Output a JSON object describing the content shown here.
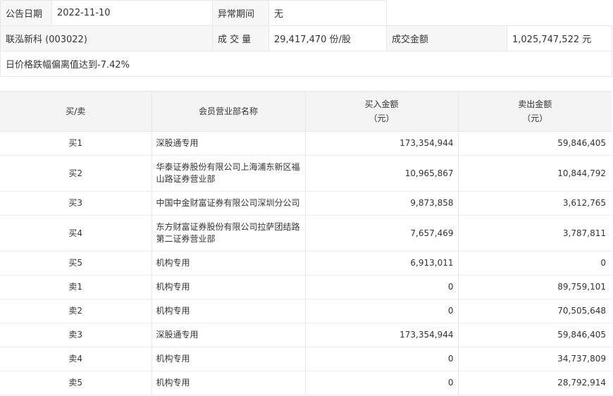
{
  "info": {
    "date_label": "公告日期",
    "date_value": "2022-11-10",
    "period_label": "异常期间",
    "period_value": "无",
    "stock": "联泓新科 (003022)",
    "volume_label": "成 交 量",
    "volume_value": "29,417,470 份/股",
    "amount_label": "成交金额",
    "amount_value": "1,025,747,522 元",
    "reason": "日价格跌幅偏离值达到-7.42%"
  },
  "table": {
    "headers": {
      "side": "买/卖",
      "name": "会员营业部名称",
      "buy": "买入金额",
      "buy_unit": "（元）",
      "sell": "卖出金额",
      "sell_unit": "（元）"
    },
    "rows": [
      {
        "side": "买1",
        "name": "深股通专用",
        "buy": "173,354,944",
        "sell": "59,846,405"
      },
      {
        "side": "买2",
        "name": "华泰证券股份有限公司上海浦东新区福山路证券营业部",
        "buy": "10,965,867",
        "sell": "10,844,792"
      },
      {
        "side": "买3",
        "name": "中国中金财富证券有限公司深圳分公司",
        "buy": "9,873,858",
        "sell": "3,612,765"
      },
      {
        "side": "买4",
        "name": "东方财富证券股份有限公司拉萨团结路第二证券营业部",
        "buy": "7,657,469",
        "sell": "3,787,811"
      },
      {
        "side": "买5",
        "name": "机构专用",
        "buy": "6,913,011",
        "sell": "0"
      },
      {
        "side": "卖1",
        "name": "机构专用",
        "buy": "0",
        "sell": "89,759,101"
      },
      {
        "side": "卖2",
        "name": "机构专用",
        "buy": "0",
        "sell": "70,505,648"
      },
      {
        "side": "卖3",
        "name": "深股通专用",
        "buy": "173,354,944",
        "sell": "59,846,405"
      },
      {
        "side": "卖4",
        "name": "机构专用",
        "buy": "0",
        "sell": "34,737,809"
      },
      {
        "side": "卖5",
        "name": "机构专用",
        "buy": "0",
        "sell": "28,792,914"
      }
    ]
  }
}
